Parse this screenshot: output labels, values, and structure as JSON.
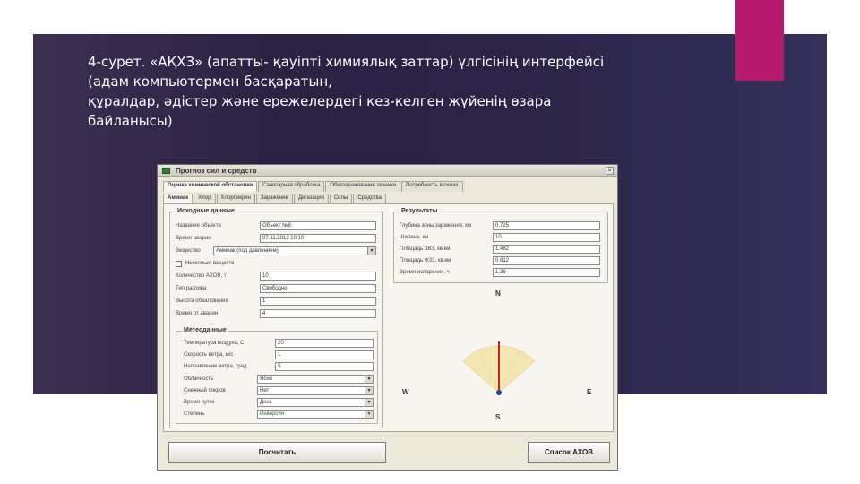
{
  "caption": {
    "line1": "4-сурет. «АҚХЗ» (апатты- қауіпті химиялық заттар) үлгісінің интерфейсі",
    "line2": "(адам компьютермен басқаратын,",
    "line3": "құралдар, әдістер және ережелердегі кез-келген жүйенің өзара",
    "line4": "байланысы)"
  },
  "window": {
    "title": "Прогноз сил и средств",
    "close_glyph": "×",
    "tabs_row1": [
      "Оценка химической обстановки",
      "Санитарная обработка",
      "Обеззараживание техники",
      "Потребность в силах"
    ],
    "tabs_row2": [
      "Аммиак",
      "Хлор",
      "Хлорпикрин",
      "Заражение",
      "Дегазация",
      "Силы",
      "Средства"
    ],
    "input": {
      "title": "Исходные данные",
      "object_label": "Название объекта",
      "object_value": "Объект №8",
      "time_label": "Время аварии",
      "time_value": "07.11.2012 10:10",
      "substance_label": "Вещество",
      "substance_value": "Аммиак (под давлением)",
      "checkbox_label": "Несколько веществ",
      "amount_label": "Количество АХОВ, т",
      "amount_value": "10",
      "terrain_label": "Тип разлива",
      "terrain_value": "Свободно",
      "height_label": "Высота обвалования",
      "height_value": "1",
      "time_after_label": "Время от аварии",
      "time_after_value": "4"
    },
    "meteo": {
      "title": "Метеоданные",
      "temp_label": "Температура воздуха, С",
      "temp_value": "20",
      "wind_speed_label": "Скорость ветра, м/с",
      "wind_speed_value": "1",
      "wind_dir_label": "Направление ветра, град",
      "wind_dir_value": "5",
      "cloud_label": "Облачность",
      "cloud_value": "Ясно",
      "snow_label": "Снежный покров",
      "snow_value": "Нет",
      "daytime_label": "Время суток",
      "daytime_value": "День",
      "stability_label": "Степень",
      "stability_value": "Инверсия"
    },
    "results": {
      "title": "Результаты",
      "depth_label": "Глубина зоны заражения, км",
      "depth_value": "0.725",
      "width_label": "Ширина, км",
      "width_value": "10",
      "area_pz_label": "Площадь ЗВЗ, кв.км",
      "area_pz_value": "1.482",
      "area_fz_label": "Площадь ФЗЗ, кв.км",
      "area_fz_value": "0.812",
      "time_label": "Время испарения, ч",
      "time_value": "1.36"
    },
    "compass": {
      "n": "N",
      "s": "S",
      "w": "W",
      "e": "E"
    },
    "buttons": {
      "calc": "Посчитать",
      "list": "Список АХОВ"
    }
  }
}
